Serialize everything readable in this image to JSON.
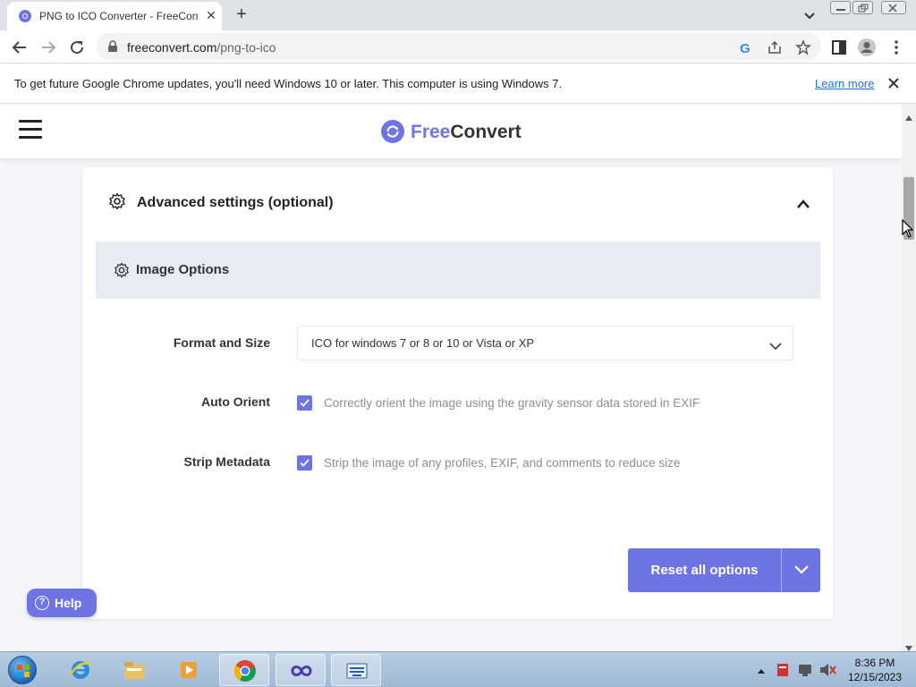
{
  "browser": {
    "tab": {
      "title": "PNG to ICO Converter - FreeConvert"
    },
    "url": {
      "host": "freeconvert.com",
      "path": "/png-to-ico"
    },
    "infobar": {
      "message": "To get future Google Chrome updates, you'll need Windows 10 or later. This computer is using Windows 7.",
      "link": "Learn more"
    }
  },
  "site": {
    "logo": {
      "part1": "Free",
      "part2": "Convert"
    },
    "accent_color": "#6f74e4"
  },
  "settings": {
    "section_title": "Advanced settings (optional)",
    "group_title": "Image Options",
    "format": {
      "label": "Format and Size",
      "selected": "ICO for windows 7 or 8 or 10 or Vista or XP"
    },
    "auto_orient": {
      "label": "Auto Orient",
      "checked": true,
      "description": "Correctly orient the image using the gravity sensor data stored in EXIF"
    },
    "strip_metadata": {
      "label": "Strip Metadata",
      "checked": true,
      "description": "Strip the image of any profiles, EXIF, and comments to reduce size"
    },
    "reset_label": "Reset all options"
  },
  "help": {
    "label": "Help"
  },
  "taskbar": {
    "apps": [
      "internet-explorer-icon",
      "file-explorer-icon",
      "media-player-icon",
      "chrome-icon",
      "infinity-app-icon",
      "on-screen-keyboard-icon"
    ],
    "time": "8:36 PM",
    "date": "12/15/2023"
  }
}
